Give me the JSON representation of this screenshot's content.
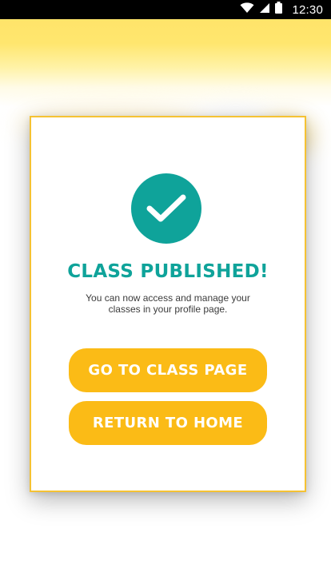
{
  "status_bar": {
    "time": "12:30",
    "icons": [
      "wifi-icon",
      "cellular-signal-icon",
      "battery-icon"
    ]
  },
  "modal": {
    "icon": "checkmark-icon",
    "title": "CLASS PUBLISHED!",
    "message": "You can now access and manage your classes in your profile page.",
    "buttons": {
      "go_to_class": "GO TO CLASS PAGE",
      "return_home": "RETURN TO HOME"
    }
  },
  "colors": {
    "accent_teal": "#0fa39a",
    "button_yellow": "#fbbb16",
    "modal_border": "#f5c233",
    "header_yellow": "#ffe46a"
  }
}
